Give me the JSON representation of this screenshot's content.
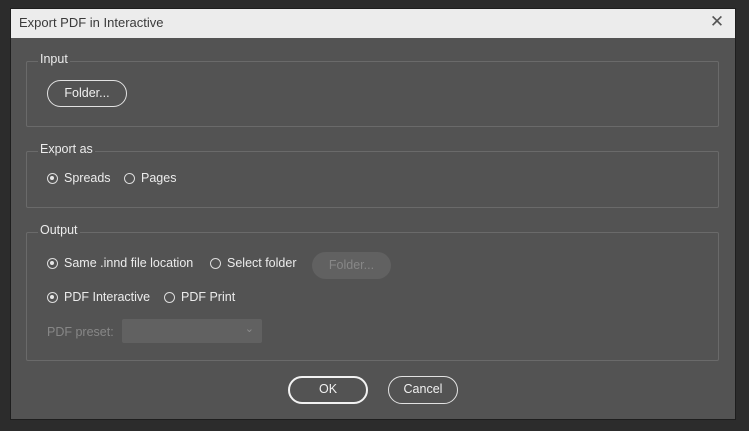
{
  "window": {
    "title": "Export PDF in Interactive",
    "close_icon": "close-icon"
  },
  "input_group": {
    "legend": "Input",
    "folder_button": "Folder..."
  },
  "export_group": {
    "legend": "Export as",
    "options": [
      {
        "label": "Spreads",
        "checked": true
      },
      {
        "label": "Pages",
        "checked": false
      }
    ]
  },
  "output_group": {
    "legend": "Output",
    "location_options": [
      {
        "label": "Same .innd file location",
        "checked": true
      },
      {
        "label": "Select folder",
        "checked": false
      }
    ],
    "folder_button": "Folder...",
    "format_options": [
      {
        "label": "PDF Interactive",
        "checked": true
      },
      {
        "label": "PDF Print",
        "checked": false
      }
    ],
    "preset_label": "PDF preset:",
    "preset_value": ""
  },
  "footer": {
    "ok_label": "OK",
    "cancel_label": "Cancel"
  }
}
